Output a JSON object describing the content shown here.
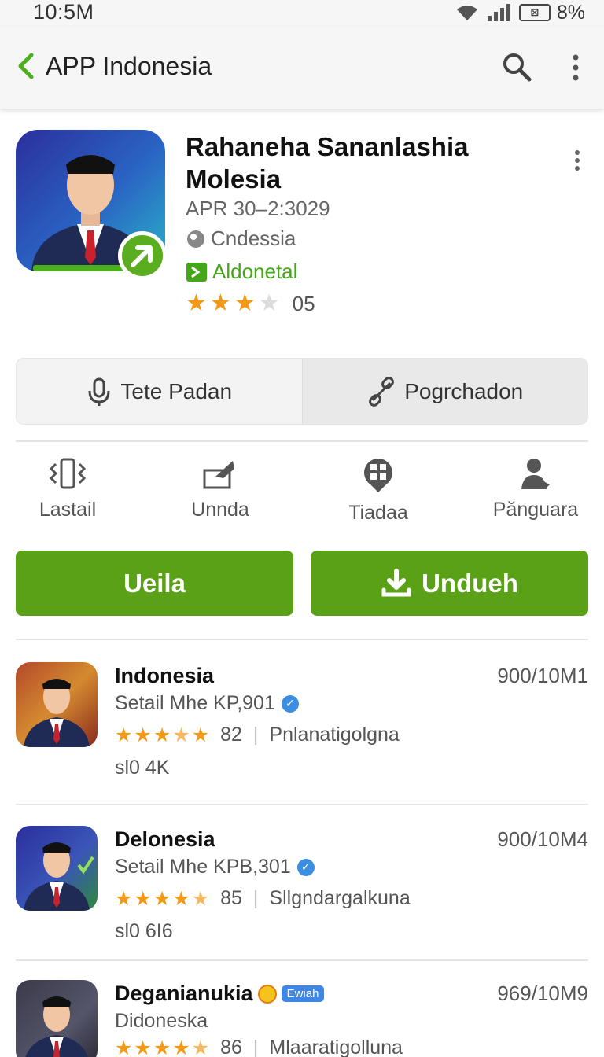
{
  "status_bar": {
    "time": "10:5M",
    "battery_icon_text": "⊠",
    "battery_percent": "8%"
  },
  "app_bar": {
    "title": "APP Indonesia"
  },
  "app_header": {
    "name_line1": "Rahaneha Sananlashia",
    "name_line2": "Molesia",
    "date": "APR 30–2:3029",
    "region": "Cndessia",
    "developer": "Aldonetal",
    "rating_stars": 3,
    "rating_count": "05"
  },
  "segments": [
    {
      "label": "Tete Padan",
      "icon": "microphone-icon"
    },
    {
      "label": "Pogrchadon",
      "icon": "link-icon"
    }
  ],
  "actions": [
    {
      "label": "Lastail",
      "icon": "vibrate-icon"
    },
    {
      "label": "Unnda",
      "icon": "share-icon"
    },
    {
      "label": "Tiadaa",
      "icon": "grid-pin-icon"
    },
    {
      "label": "Pănguara",
      "icon": "person-icon"
    }
  ],
  "buttons": {
    "left": "Ueila",
    "right": "Undueh"
  },
  "list": [
    {
      "title": "Indonesia",
      "date": "900/10M1",
      "subtitle": "Setail Mhe KP,901",
      "rating": 3.5,
      "rating_num": "82",
      "tag": "Pnlanatigolgna",
      "size": "sl0 4K"
    },
    {
      "title": "Delonesia",
      "date": "900/10M4",
      "subtitle": "Setail Mhe KPB,301",
      "rating": 4.5,
      "rating_num": "85",
      "tag": "Sllgndargalkuna",
      "size": "sl0 6I6"
    },
    {
      "title": "Deganianukia",
      "badge": "Ewiah",
      "date": "969/10M9",
      "subtitle": "Didoneska",
      "rating": 4.5,
      "rating_num": "86",
      "tag": "Mlaaratigolluna"
    }
  ],
  "colors": {
    "accent_green": "#5aa117",
    "developer_green": "#44a61a",
    "star": "#f29a17"
  }
}
